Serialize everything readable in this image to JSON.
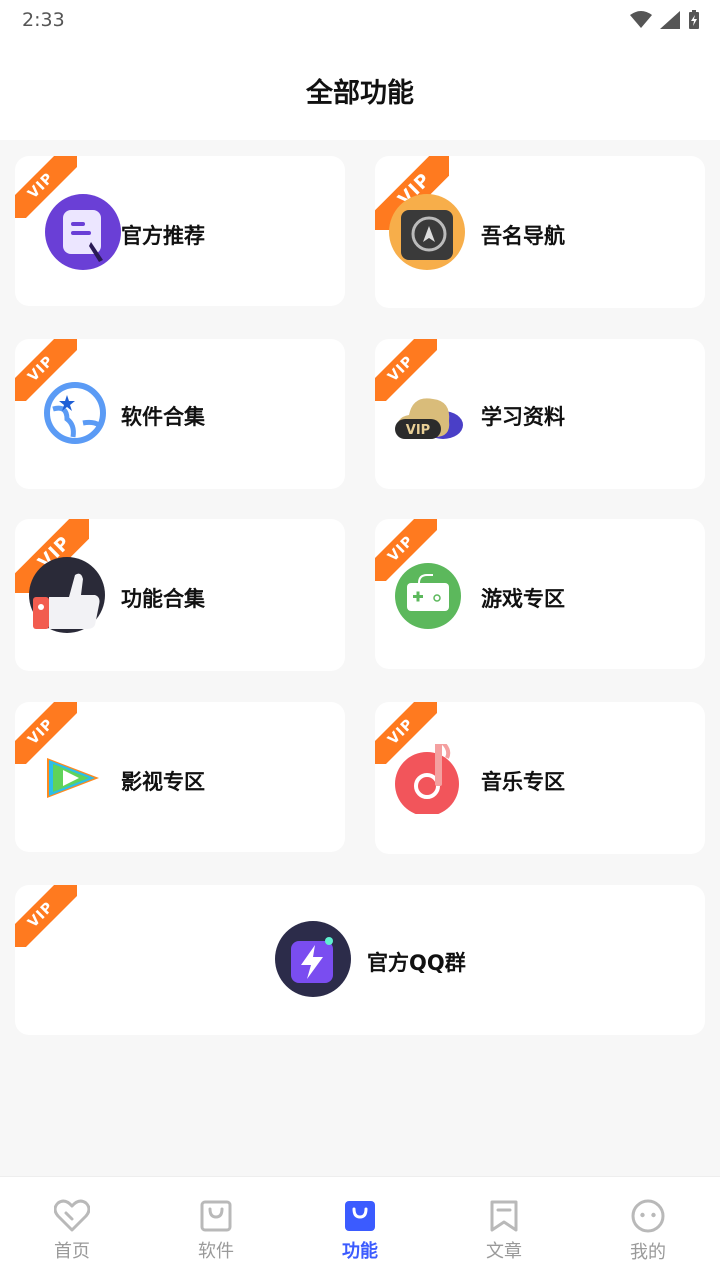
{
  "status": {
    "time": "2:33"
  },
  "header": {
    "title": "全部功能"
  },
  "badge": {
    "text": "VIP",
    "color": "#ff7a1f"
  },
  "cards": [
    {
      "label": "官方推荐",
      "icon": "note-pen-icon"
    },
    {
      "label": "吾名导航",
      "icon": "compass-icon"
    },
    {
      "label": "软件合集",
      "icon": "globe-icon"
    },
    {
      "label": "学习资料",
      "icon": "vip-cloud-icon"
    },
    {
      "label": "功能合集",
      "icon": "thumbs-up-icon"
    },
    {
      "label": "游戏专区",
      "icon": "gamepad-icon"
    },
    {
      "label": "影视专区",
      "icon": "play-icon"
    },
    {
      "label": "音乐专区",
      "icon": "music-note-icon"
    },
    {
      "label": "官方QQ群",
      "icon": "lightning-icon"
    }
  ],
  "tabs": [
    {
      "label": "首页",
      "icon": "heart-icon",
      "active": false
    },
    {
      "label": "软件",
      "icon": "bag-icon",
      "active": false
    },
    {
      "label": "功能",
      "icon": "bag-filled-icon",
      "active": true
    },
    {
      "label": "文章",
      "icon": "bookmark-icon",
      "active": false
    },
    {
      "label": "我的",
      "icon": "smile-face-icon",
      "active": false
    }
  ],
  "colors": {
    "accent": "#3b5bff",
    "inactive_tab": "#9a9a9a"
  }
}
